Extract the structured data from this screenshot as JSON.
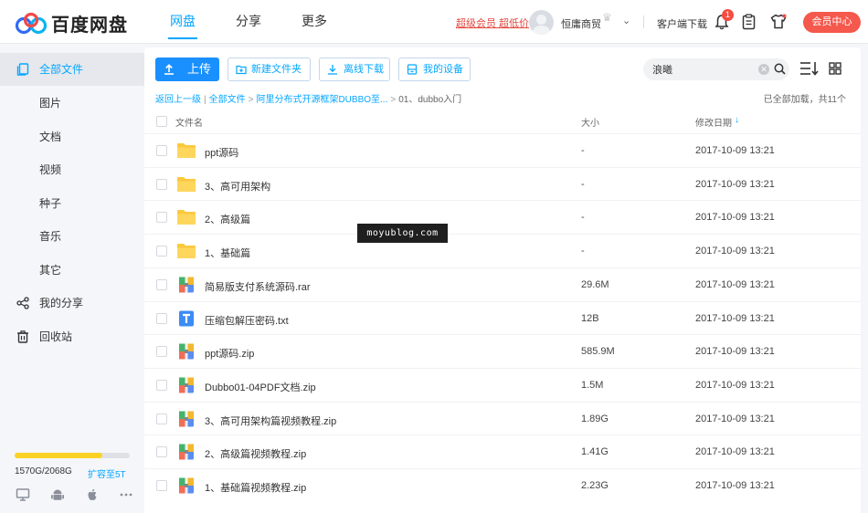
{
  "header": {
    "logo_text": "百度网盘",
    "nav": [
      "网盘",
      "分享",
      "更多"
    ],
    "vip_promo": "超级会员 超低价",
    "username": "恒庸商贸",
    "client_download": "客户端下载",
    "notification_count": "1",
    "vip_center": "会员中心"
  },
  "sidebar": {
    "items": [
      {
        "label": "全部文件",
        "icon": "files-icon"
      },
      {
        "label": "图片"
      },
      {
        "label": "文档"
      },
      {
        "label": "视频"
      },
      {
        "label": "种子"
      },
      {
        "label": "音乐"
      },
      {
        "label": "其它"
      },
      {
        "label": "我的分享",
        "icon": "share-icon"
      },
      {
        "label": "回收站",
        "icon": "trash-icon"
      }
    ],
    "storage": "1570G/2068G",
    "storage_fraction": 0.759,
    "expand_label": "扩容至5T",
    "devices": [
      "pc-icon",
      "android-icon",
      "apple-icon",
      "more-icon"
    ]
  },
  "toolbar": {
    "upload": "上传",
    "new_folder": "新建文件夹",
    "offline_download": "离线下载",
    "my_devices": "我的设备",
    "search_value": "浪曦"
  },
  "breadcrumb": {
    "back": "返回上一级",
    "items": [
      "全部文件",
      "阿里分布式开源框架DUBBO至...",
      "01、dubbo入门"
    ],
    "status": "已全部加载，共11个"
  },
  "table": {
    "headers": {
      "name": "文件名",
      "size": "大小",
      "date": "修改日期"
    },
    "rows": [
      {
        "name": "ppt源码",
        "size": "-",
        "date": "2017-10-09 13:21",
        "type": "folder"
      },
      {
        "name": "3、高可用架构",
        "size": "-",
        "date": "2017-10-09 13:21",
        "type": "folder"
      },
      {
        "name": "2、高级篇",
        "size": "-",
        "date": "2017-10-09 13:21",
        "type": "folder"
      },
      {
        "name": "1、基础篇",
        "size": "-",
        "date": "2017-10-09 13:21",
        "type": "folder"
      },
      {
        "name": "简易版支付系统源码.rar",
        "size": "29.6M",
        "date": "2017-10-09 13:21",
        "type": "archive"
      },
      {
        "name": "压缩包解压密码.txt",
        "size": "12B",
        "date": "2017-10-09 13:21",
        "type": "text"
      },
      {
        "name": "ppt源码.zip",
        "size": "585.9M",
        "date": "2017-10-09 13:21",
        "type": "archive"
      },
      {
        "name": "Dubbo01-04PDF文档.zip",
        "size": "1.5M",
        "date": "2017-10-09 13:21",
        "type": "archive"
      },
      {
        "name": "3、高可用架构篇视频教程.zip",
        "size": "1.89G",
        "date": "2017-10-09 13:21",
        "type": "archive"
      },
      {
        "name": "2、高级篇视频教程.zip",
        "size": "1.41G",
        "date": "2017-10-09 13:21",
        "type": "archive"
      },
      {
        "name": "1、基础篇视频教程.zip",
        "size": "2.23G",
        "date": "2017-10-09 13:21",
        "type": "archive"
      }
    ]
  },
  "watermark": "moyublog.com",
  "colors": {
    "accent": "#06a7ff",
    "primary_button": "#1a90ff",
    "vip": "#f5584c",
    "storage_fill": "#fcd224"
  }
}
